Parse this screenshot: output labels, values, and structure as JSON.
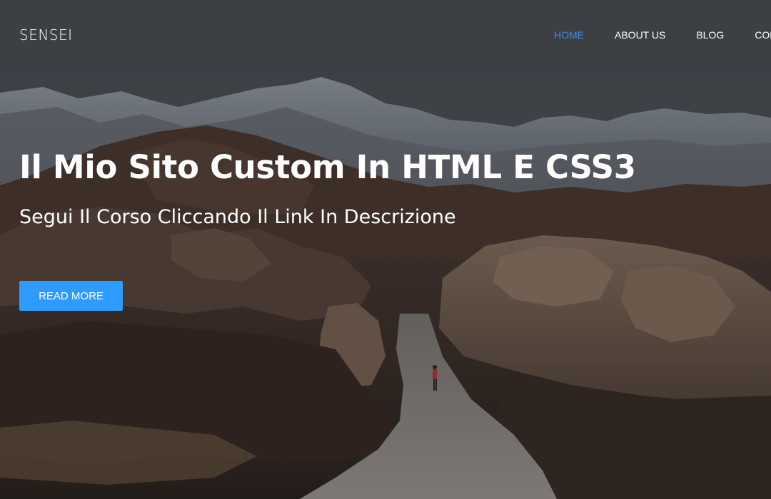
{
  "brand": {
    "name": "SENSEI"
  },
  "nav": {
    "items": [
      {
        "label": "HOME",
        "active": true
      },
      {
        "label": "ABOUT US",
        "active": false
      },
      {
        "label": "BLOG",
        "active": false
      },
      {
        "label": "CONTACT",
        "active": false
      }
    ]
  },
  "hero": {
    "title": "Il Mio Sito Custom In HTML E CSS3",
    "subtitle": "Segui Il Corso Cliccando Il Link In Descrizione",
    "button_label": "READ MORE"
  },
  "colors": {
    "accent": "#2e9bff",
    "active_nav": "#3c8dde",
    "text": "#ffffff"
  }
}
